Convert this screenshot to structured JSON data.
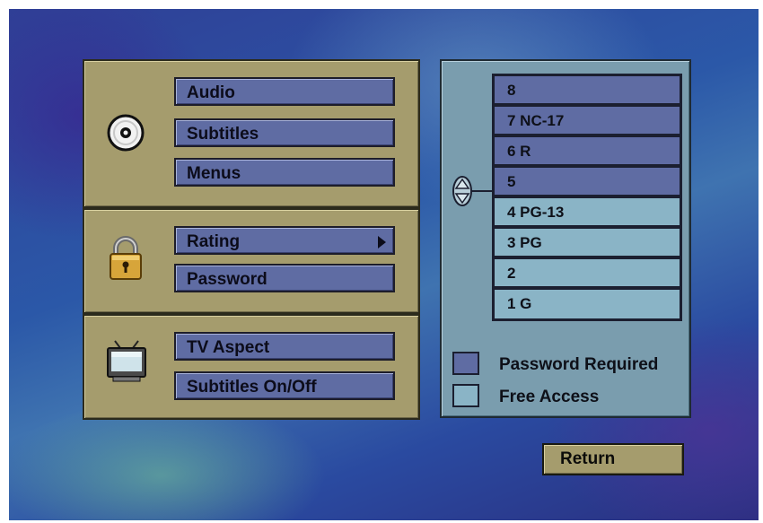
{
  "menu": {
    "disc_section": {
      "icon": "disc-icon",
      "items": [
        "Audio",
        "Subtitles",
        "Menus"
      ]
    },
    "parental_section": {
      "icon": "padlock-icon",
      "items": [
        "Rating",
        "Password"
      ],
      "selected": "Rating"
    },
    "display_section": {
      "icon": "television-icon",
      "items": [
        "TV Aspect",
        "Subtitles On/Off"
      ]
    }
  },
  "rating": {
    "levels": [
      "8",
      "7 NC-17",
      "6 R",
      "5",
      "4 PG-13",
      "3 PG",
      "2",
      "1 G"
    ],
    "current_level": "5",
    "scroll_icon": "up-down-arrow-icon"
  },
  "legend": {
    "password_required": "Password Required",
    "free_access": "Free Access"
  },
  "colors": {
    "password_required": "#5f6ca3",
    "free_access": "#8ab4c6",
    "panel_gold": "#a59c6d",
    "panel_blue": "#7a9dae"
  },
  "buttons": {
    "return": "Return"
  }
}
